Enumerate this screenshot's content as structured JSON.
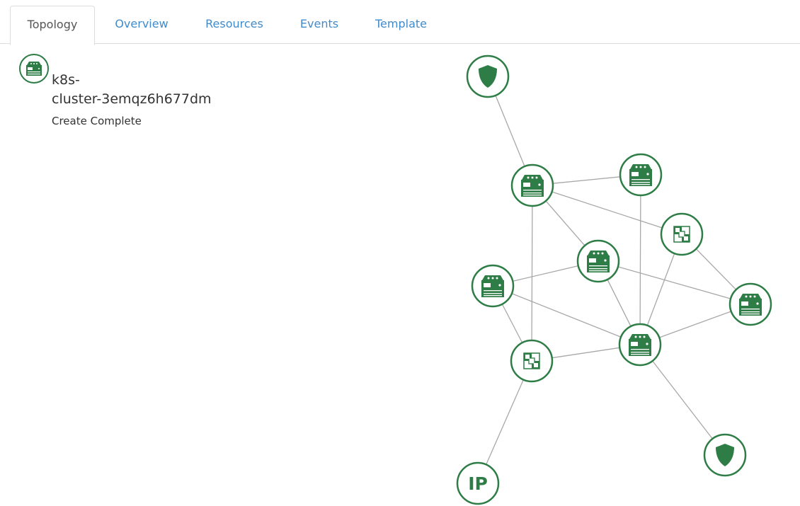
{
  "tabs": [
    {
      "label": "Topology",
      "active": true
    },
    {
      "label": "Overview",
      "active": false
    },
    {
      "label": "Resources",
      "active": false
    },
    {
      "label": "Events",
      "active": false
    },
    {
      "label": "Template",
      "active": false
    }
  ],
  "stack": {
    "name": "k8s-cluster-3emqz6h677dm",
    "status": "Create Complete",
    "icon": "server-icon"
  },
  "colors": {
    "node_green": "#2e7d46",
    "edge_gray": "#a8a8a8",
    "tab_link": "#428bca"
  },
  "topology": {
    "nodes": [
      {
        "id": "sg-top",
        "type": "security-group"
      },
      {
        "id": "server-a",
        "type": "server"
      },
      {
        "id": "server-b",
        "type": "server"
      },
      {
        "id": "net-right",
        "type": "network"
      },
      {
        "id": "server-c",
        "type": "server"
      },
      {
        "id": "server-d",
        "type": "server"
      },
      {
        "id": "server-e",
        "type": "server"
      },
      {
        "id": "server-f",
        "type": "server"
      },
      {
        "id": "net-left",
        "type": "network"
      },
      {
        "id": "sg-bottom",
        "type": "security-group"
      },
      {
        "id": "floating-ip",
        "type": "ip",
        "label": "IP"
      }
    ],
    "edges": [
      [
        "sg-top",
        "server-a"
      ],
      [
        "server-a",
        "server-b"
      ],
      [
        "server-a",
        "net-right"
      ],
      [
        "server-a",
        "server-c"
      ],
      [
        "server-a",
        "net-left"
      ],
      [
        "server-b",
        "server-f"
      ],
      [
        "net-right",
        "server-e"
      ],
      [
        "net-right",
        "server-f"
      ],
      [
        "server-c",
        "server-d"
      ],
      [
        "server-c",
        "server-e"
      ],
      [
        "server-c",
        "server-f"
      ],
      [
        "server-d",
        "net-left"
      ],
      [
        "server-d",
        "server-f"
      ],
      [
        "server-e",
        "server-f"
      ],
      [
        "net-left",
        "server-f"
      ],
      [
        "net-left",
        "floating-ip"
      ],
      [
        "server-f",
        "sg-bottom"
      ]
    ]
  }
}
